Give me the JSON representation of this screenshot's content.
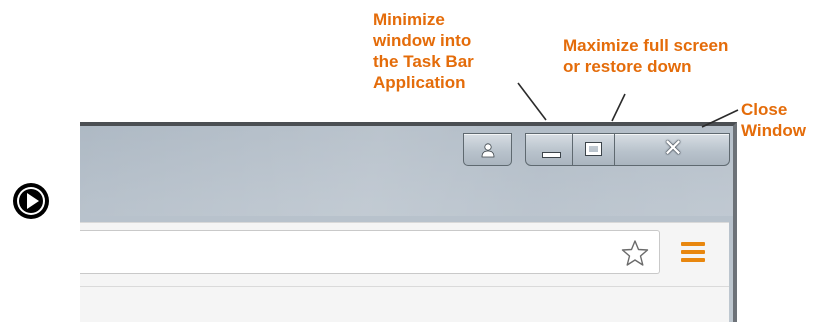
{
  "annotations": {
    "minimize": "Minimize\nwindow into\nthe Task Bar\nApplication",
    "maximize": "Maximize full screen\nor restore down",
    "close": "Close\nWindow"
  },
  "icons": {
    "play": "play-icon",
    "profile": "profile-icon",
    "minimize": "minimize-icon",
    "maximize": "maximize-icon",
    "close": "close-icon",
    "bookmark": "star-icon",
    "menu": "hamburger-menu-icon"
  },
  "colors": {
    "annotation": "#e46c0a",
    "menu_icon": "#e8870f",
    "title_bar": "#b7c1cb"
  },
  "omnibox": {
    "value": ""
  }
}
